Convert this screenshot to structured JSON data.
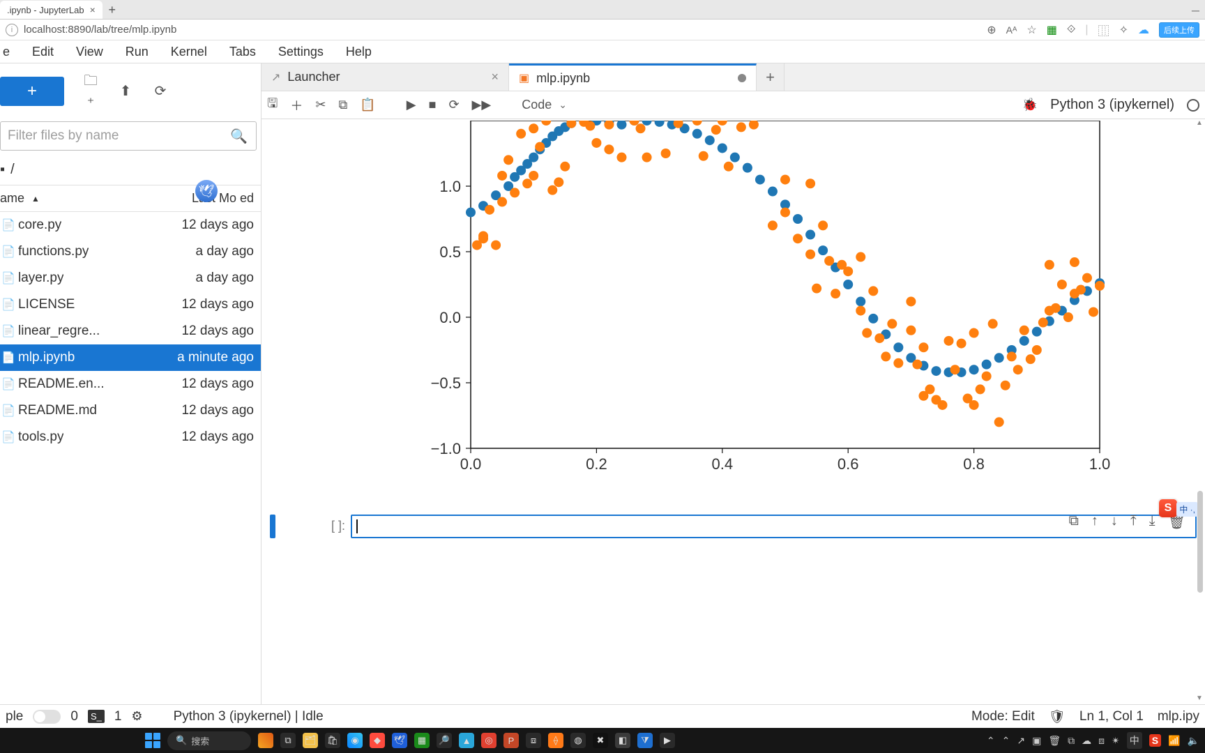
{
  "browser": {
    "tab_title": ".ipynb - JupyterLab",
    "url": "localhost:8890/lab/tree/mlp.ipynb",
    "upload_text": "后续上传"
  },
  "menu": {
    "items": [
      "e",
      "Edit",
      "View",
      "Run",
      "Kernel",
      "Tabs",
      "Settings",
      "Help"
    ]
  },
  "sidebar": {
    "filter_placeholder": "Filter files by name",
    "crumb": "/",
    "head_name": "ame",
    "head_mod": "Last Mo    ed",
    "files": [
      {
        "name": "core.py",
        "date": "12 days ago",
        "sel": false
      },
      {
        "name": "functions.py",
        "date": "a day ago",
        "sel": false
      },
      {
        "name": "layer.py",
        "date": "a day ago",
        "sel": false
      },
      {
        "name": "LICENSE",
        "date": "12 days ago",
        "sel": false
      },
      {
        "name": "linear_regre...",
        "date": "12 days ago",
        "sel": false
      },
      {
        "name": "mlp.ipynb",
        "date": "a minute ago",
        "sel": true
      },
      {
        "name": "README.en...",
        "date": "12 days ago",
        "sel": false
      },
      {
        "name": "README.md",
        "date": "12 days ago",
        "sel": false
      },
      {
        "name": "tools.py",
        "date": "12 days ago",
        "sel": false
      }
    ]
  },
  "tabs": {
    "launcher": "Launcher",
    "notebook": "mlp.ipynb",
    "newtab": "+"
  },
  "nbtoolbar": {
    "celltype": "Code",
    "kernel": "Python 3 (ipykernel)"
  },
  "cell": {
    "prompt": "[  ]:"
  },
  "statusbar": {
    "ple": "ple",
    "zero": "0",
    "s": "S_",
    "one": "1",
    "kernel": "Python 3 (ipykernel) | Idle",
    "mode": "Mode: Edit",
    "lncol": "Ln 1, Col 1",
    "fname": "mlp.ipy"
  },
  "taskbar": {
    "search": "搜索",
    "ime": "中"
  },
  "chart_data": {
    "type": "scatter",
    "x_ticks": [
      0.0,
      0.2,
      0.4,
      0.6,
      0.8,
      1.0
    ],
    "y_ticks": [
      -1.0,
      -0.5,
      0.0,
      0.5,
      1.0
    ],
    "xlim": [
      0.0,
      1.0
    ],
    "ylim": [
      -1.0,
      1.5
    ],
    "xlabel": "",
    "ylabel": "",
    "title": "",
    "series": [
      {
        "name": "blue",
        "color": "#1f77b4",
        "points": [
          [
            0.0,
            0.8
          ],
          [
            0.02,
            0.85
          ],
          [
            0.04,
            0.93
          ],
          [
            0.06,
            1.0
          ],
          [
            0.07,
            1.07
          ],
          [
            0.08,
            1.12
          ],
          [
            0.09,
            1.17
          ],
          [
            0.1,
            1.22
          ],
          [
            0.11,
            1.28
          ],
          [
            0.12,
            1.33
          ],
          [
            0.13,
            1.38
          ],
          [
            0.14,
            1.42
          ],
          [
            0.15,
            1.45
          ],
          [
            0.16,
            1.48
          ],
          [
            0.18,
            1.5
          ],
          [
            0.2,
            1.5
          ],
          [
            0.22,
            1.49
          ],
          [
            0.24,
            1.47
          ],
          [
            0.26,
            1.5
          ],
          [
            0.28,
            1.5
          ],
          [
            0.3,
            1.49
          ],
          [
            0.32,
            1.47
          ],
          [
            0.34,
            1.44
          ],
          [
            0.36,
            1.4
          ],
          [
            0.38,
            1.35
          ],
          [
            0.4,
            1.29
          ],
          [
            0.42,
            1.22
          ],
          [
            0.44,
            1.14
          ],
          [
            0.46,
            1.05
          ],
          [
            0.48,
            0.96
          ],
          [
            0.5,
            0.86
          ],
          [
            0.52,
            0.75
          ],
          [
            0.54,
            0.63
          ],
          [
            0.56,
            0.51
          ],
          [
            0.58,
            0.38
          ],
          [
            0.6,
            0.25
          ],
          [
            0.62,
            0.12
          ],
          [
            0.64,
            -0.01
          ],
          [
            0.66,
            -0.13
          ],
          [
            0.68,
            -0.23
          ],
          [
            0.7,
            -0.31
          ],
          [
            0.72,
            -0.37
          ],
          [
            0.74,
            -0.41
          ],
          [
            0.76,
            -0.42
          ],
          [
            0.78,
            -0.42
          ],
          [
            0.8,
            -0.4
          ],
          [
            0.82,
            -0.36
          ],
          [
            0.84,
            -0.31
          ],
          [
            0.86,
            -0.25
          ],
          [
            0.88,
            -0.18
          ],
          [
            0.9,
            -0.11
          ],
          [
            0.92,
            -0.03
          ],
          [
            0.94,
            0.05
          ],
          [
            0.96,
            0.13
          ],
          [
            0.98,
            0.2
          ],
          [
            1.0,
            0.26
          ]
        ]
      },
      {
        "name": "orange",
        "color": "#ff7f0e",
        "points": [
          [
            0.01,
            0.55
          ],
          [
            0.02,
            0.6
          ],
          [
            0.03,
            0.82
          ],
          [
            0.02,
            0.62
          ],
          [
            0.05,
            0.88
          ],
          [
            0.05,
            1.08
          ],
          [
            0.04,
            0.55
          ],
          [
            0.06,
            1.2
          ],
          [
            0.07,
            0.95
          ],
          [
            0.08,
            1.4
          ],
          [
            0.09,
            1.02
          ],
          [
            0.1,
            1.08
          ],
          [
            0.1,
            1.44
          ],
          [
            0.11,
            1.3
          ],
          [
            0.12,
            1.5
          ],
          [
            0.13,
            0.97
          ],
          [
            0.14,
            1.03
          ],
          [
            0.15,
            1.15
          ],
          [
            0.16,
            1.48
          ],
          [
            0.18,
            1.49
          ],
          [
            0.19,
            1.46
          ],
          [
            0.2,
            1.33
          ],
          [
            0.22,
            1.47
          ],
          [
            0.22,
            1.28
          ],
          [
            0.24,
            1.22
          ],
          [
            0.26,
            1.5
          ],
          [
            0.27,
            1.44
          ],
          [
            0.28,
            1.22
          ],
          [
            0.31,
            1.25
          ],
          [
            0.33,
            1.48
          ],
          [
            0.36,
            1.5
          ],
          [
            0.37,
            1.23
          ],
          [
            0.39,
            1.43
          ],
          [
            0.4,
            1.5
          ],
          [
            0.41,
            1.15
          ],
          [
            0.43,
            1.45
          ],
          [
            0.45,
            1.47
          ],
          [
            0.48,
            0.7
          ],
          [
            0.5,
            0.8
          ],
          [
            0.5,
            1.05
          ],
          [
            0.52,
            0.6
          ],
          [
            0.54,
            0.48
          ],
          [
            0.54,
            1.02
          ],
          [
            0.55,
            0.22
          ],
          [
            0.56,
            0.7
          ],
          [
            0.57,
            0.43
          ],
          [
            0.58,
            0.18
          ],
          [
            0.59,
            0.4
          ],
          [
            0.6,
            0.35
          ],
          [
            0.62,
            0.05
          ],
          [
            0.62,
            0.46
          ],
          [
            0.63,
            -0.12
          ],
          [
            0.64,
            0.2
          ],
          [
            0.65,
            -0.16
          ],
          [
            0.66,
            -0.3
          ],
          [
            0.67,
            -0.05
          ],
          [
            0.68,
            -0.35
          ],
          [
            0.7,
            -0.1
          ],
          [
            0.7,
            0.12
          ],
          [
            0.71,
            -0.36
          ],
          [
            0.72,
            -0.23
          ],
          [
            0.72,
            -0.6
          ],
          [
            0.73,
            -0.55
          ],
          [
            0.74,
            -0.63
          ],
          [
            0.75,
            -0.67
          ],
          [
            0.76,
            -0.18
          ],
          [
            0.77,
            -0.4
          ],
          [
            0.78,
            -0.2
          ],
          [
            0.79,
            -0.62
          ],
          [
            0.8,
            -0.67
          ],
          [
            0.8,
            -0.12
          ],
          [
            0.81,
            -0.55
          ],
          [
            0.82,
            -0.45
          ],
          [
            0.83,
            -0.05
          ],
          [
            0.84,
            -0.8
          ],
          [
            0.85,
            -0.52
          ],
          [
            0.86,
            -0.3
          ],
          [
            0.87,
            -0.4
          ],
          [
            0.88,
            -0.1
          ],
          [
            0.89,
            -0.32
          ],
          [
            0.9,
            -0.25
          ],
          [
            0.91,
            -0.04
          ],
          [
            0.92,
            0.05
          ],
          [
            0.92,
            0.4
          ],
          [
            0.93,
            0.07
          ],
          [
            0.94,
            0.25
          ],
          [
            0.95,
            0.0
          ],
          [
            0.96,
            0.18
          ],
          [
            0.96,
            0.42
          ],
          [
            0.97,
            0.21
          ],
          [
            0.98,
            0.3
          ],
          [
            0.99,
            0.04
          ],
          [
            1.0,
            0.24
          ]
        ]
      }
    ]
  }
}
